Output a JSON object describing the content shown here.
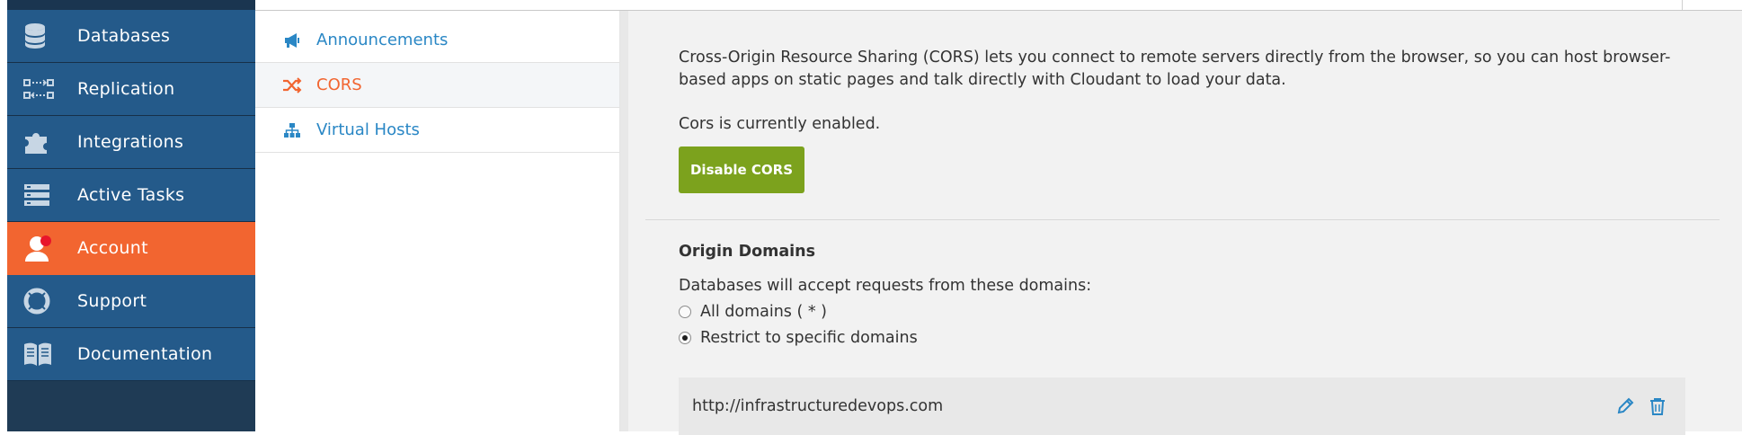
{
  "nav": {
    "items": [
      {
        "label": "Databases",
        "icon": "database-icon"
      },
      {
        "label": "Replication",
        "icon": "replication-icon"
      },
      {
        "label": "Integrations",
        "icon": "puzzle-icon"
      },
      {
        "label": "Active Tasks",
        "icon": "tasks-icon"
      },
      {
        "label": "Account",
        "icon": "user-icon",
        "active": true
      },
      {
        "label": "Support",
        "icon": "lifebuoy-icon"
      },
      {
        "label": "Documentation",
        "icon": "book-icon"
      }
    ]
  },
  "subnav": {
    "items": [
      {
        "label": "Announcements",
        "icon": "megaphone-icon"
      },
      {
        "label": "CORS",
        "icon": "shuffle-icon",
        "active": true
      },
      {
        "label": "Virtual Hosts",
        "icon": "sitemap-icon"
      }
    ]
  },
  "main": {
    "intro": "Cross-Origin Resource Sharing (CORS) lets you connect to remote servers directly from the browser, so you can host browser-based apps on static pages and talk directly with Cloudant to load your data.",
    "status": "Cors is currently enabled.",
    "disable_button": "Disable CORS",
    "origin": {
      "title": "Origin Domains",
      "description": "Databases will accept requests from these domains:",
      "options": [
        {
          "label": "All domains ( * )",
          "checked": false
        },
        {
          "label": "Restrict to specific domains",
          "checked": true
        }
      ],
      "domains": [
        "http://infrastructuredevops.com"
      ]
    }
  },
  "colors": {
    "nav_bg": "#245a8a",
    "nav_active": "#f26530",
    "link": "#2a87c5",
    "button_green": "#7ca21d"
  }
}
